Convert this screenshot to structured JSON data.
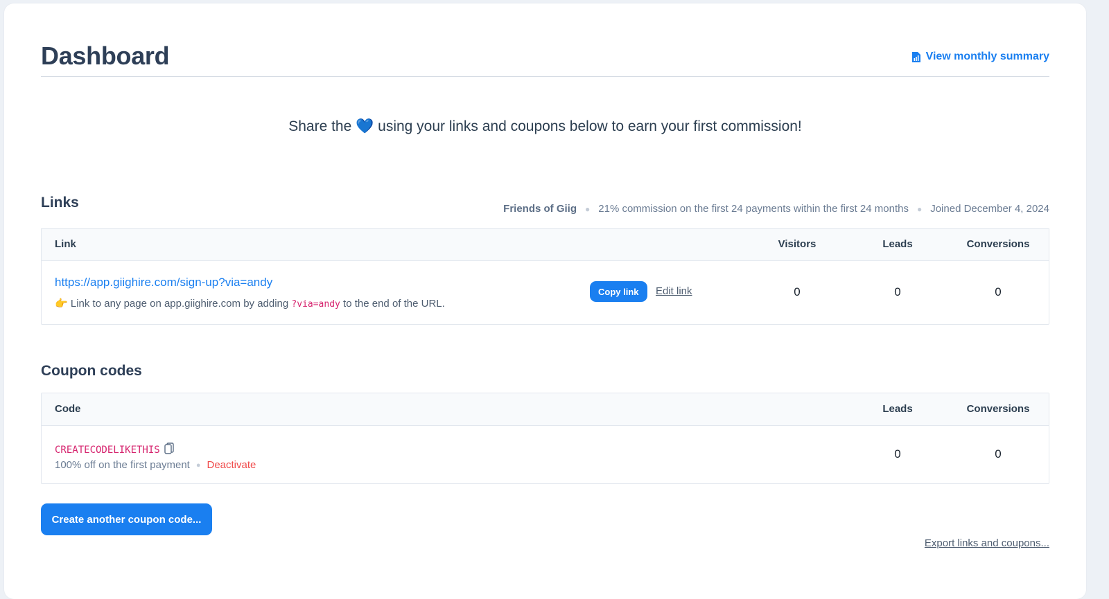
{
  "header": {
    "title": "Dashboard",
    "summary_link": "View monthly summary",
    "summary_icon": "bar-chart-document-icon"
  },
  "share_message": {
    "before": "Share the",
    "emoji": "💙",
    "after": "using your links and coupons below to earn your first commission!"
  },
  "links_section": {
    "title": "Links",
    "program_name": "Friends of Giig",
    "commission": "21% commission on the first 24 payments within the first 24 months",
    "joined": "Joined December 4, 2024",
    "columns": [
      "Link",
      "Visitors",
      "Leads",
      "Conversions"
    ],
    "rows": [
      {
        "url": "https://app.giighire.com/sign-up?via=andy",
        "hint_emoji": "👉",
        "hint_before": "Link to any page on app.giighire.com by adding",
        "hint_code": "?via=andy",
        "hint_after": "to the end of the URL.",
        "copy_label": "Copy link",
        "edit_label": "Edit link",
        "visitors": "0",
        "leads": "0",
        "conversions": "0"
      }
    ]
  },
  "coupons_section": {
    "title": "Coupon codes",
    "columns": [
      "Code",
      "Leads",
      "Conversions"
    ],
    "rows": [
      {
        "code": "CREATECODELIKETHIS",
        "description": "100% off on the first payment",
        "deactivate_label": "Deactivate",
        "leads": "0",
        "conversions": "0"
      }
    ],
    "create_label": "Create another coupon code...",
    "export_label": "Export links and coupons..."
  },
  "colors": {
    "accent": "#1a7ff0",
    "danger": "#f04a4a",
    "code": "#d6246e",
    "heading": "#2e3f57"
  }
}
